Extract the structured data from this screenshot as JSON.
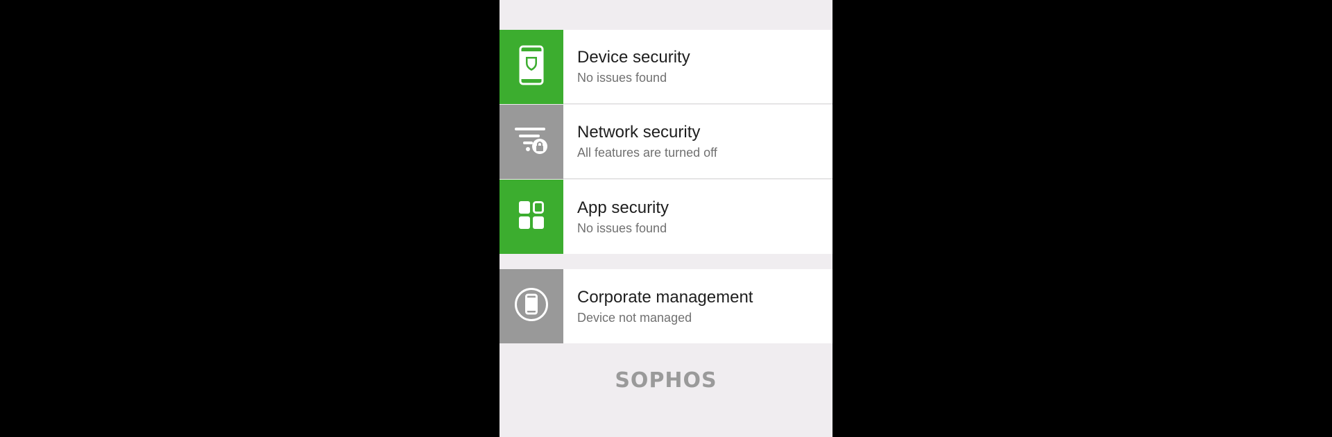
{
  "colors": {
    "green": "#3cad2f",
    "gray": "#999999",
    "background": "#f0edf0"
  },
  "items": [
    {
      "title": "Device security",
      "subtitle": "No issues found",
      "status": "ok",
      "icon": "phone-shield-icon"
    },
    {
      "title": "Network security",
      "subtitle": "All features are turned off",
      "status": "off",
      "icon": "network-filter-lock-icon"
    },
    {
      "title": "App security",
      "subtitle": "No issues found",
      "status": "ok",
      "icon": "apps-grid-icon"
    }
  ],
  "corporate": {
    "title": "Corporate management",
    "subtitle": "Device not managed",
    "status": "off",
    "icon": "phone-circle-icon"
  },
  "footer": {
    "logo": "SOPHOS"
  }
}
